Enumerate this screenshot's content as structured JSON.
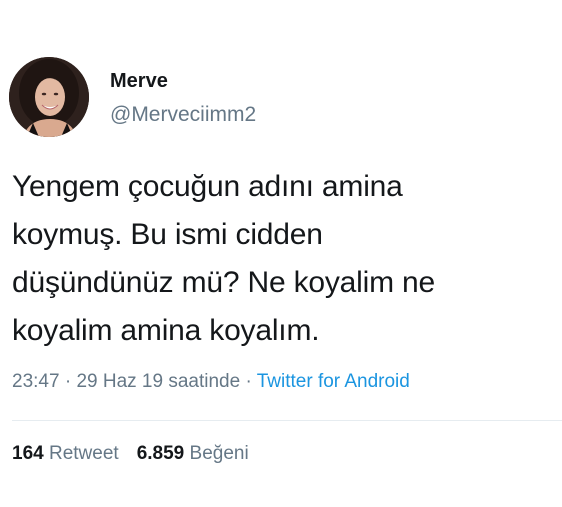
{
  "author": {
    "display_name": "Merve",
    "handle": "@Merveciimm2"
  },
  "tweet": {
    "lines": [
      "Yengem çocuğun adını amina",
      "koymuş. Bu ismi cidden",
      "düşündünüz mü? Ne koyalim ne",
      "koyalim amina koyalım."
    ]
  },
  "meta": {
    "time": "23:47",
    "sep1": "·",
    "date": "29 Haz 19 saatinde",
    "sep2": "·",
    "source": "Twitter for Android"
  },
  "stats": {
    "retweets_count": "164",
    "retweets_label": "Retweet",
    "likes_count": "6.859",
    "likes_label": "Beğeni"
  },
  "colors": {
    "text": "#14171a",
    "secondary": "#657786",
    "link": "#1b95e0",
    "divider": "#e6ecf0"
  }
}
